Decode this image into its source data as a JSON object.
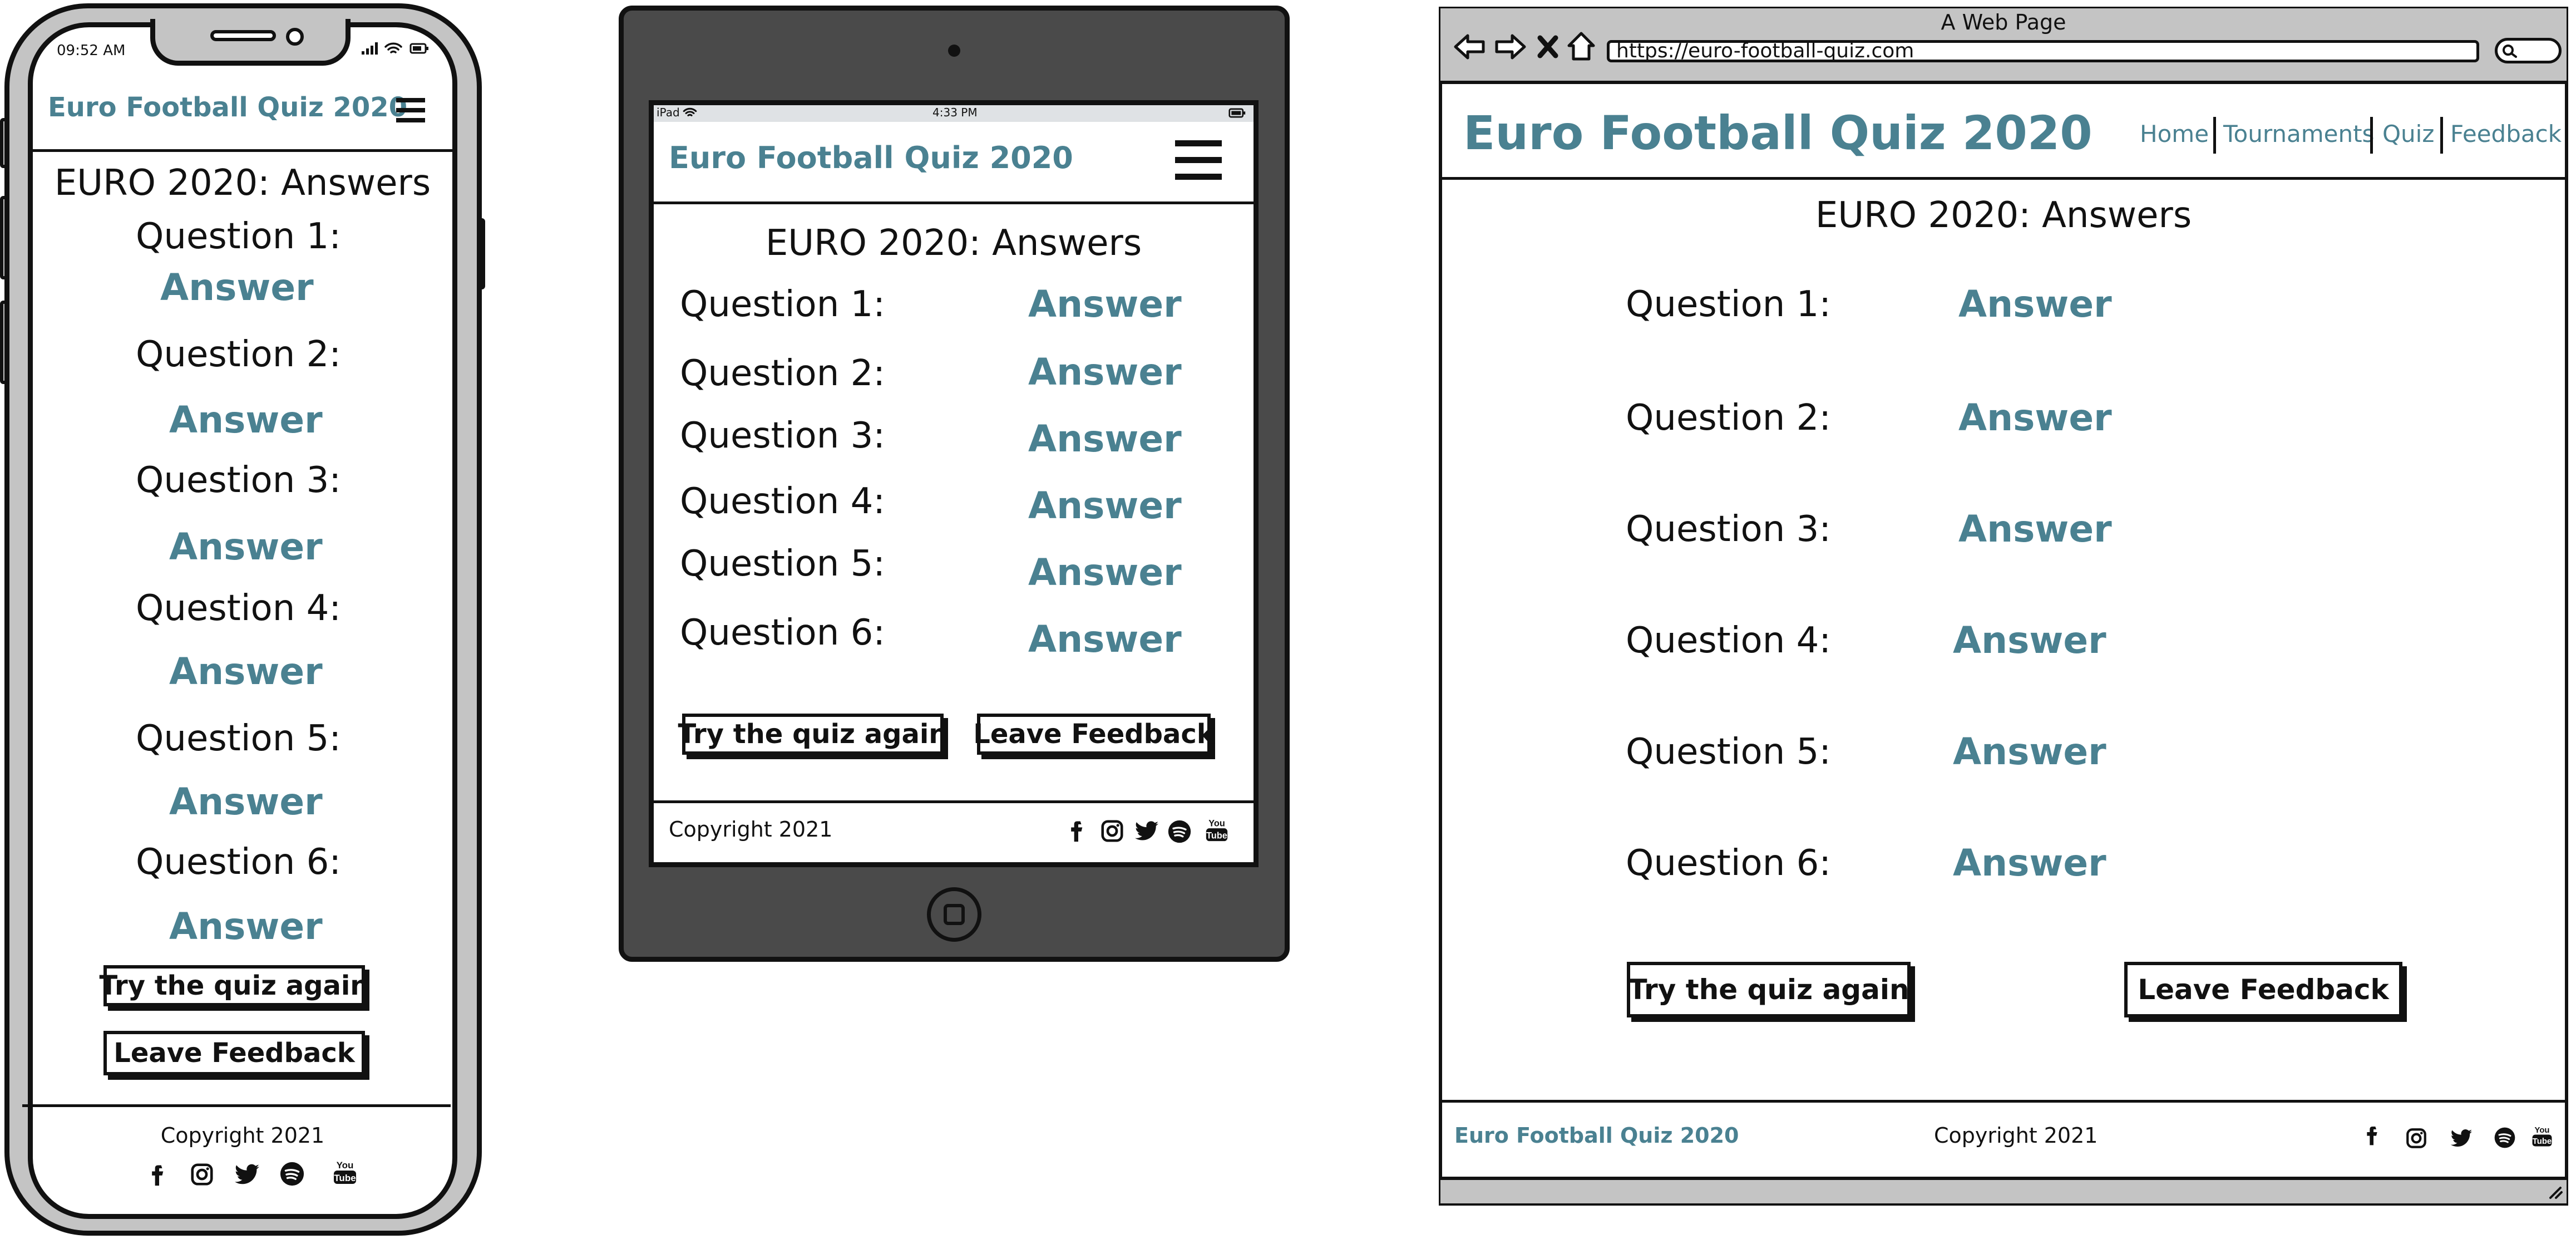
{
  "phone": {
    "status_time": "09:52 AM",
    "site_title": "Euro Football Quiz 2020",
    "heading": "EURO 2020: Answers",
    "questions": [
      {
        "label": "Question 1:",
        "answer": "Answer"
      },
      {
        "label": "Question 2:",
        "answer": "Answer"
      },
      {
        "label": "Question 3:",
        "answer": "Answer"
      },
      {
        "label": "Question 4:",
        "answer": "Answer"
      },
      {
        "label": "Question 5:",
        "answer": "Answer"
      },
      {
        "label": "Question 6:",
        "answer": "Answer"
      }
    ],
    "retry_button": "Try the quiz again",
    "feedback_button": "Leave Feedback",
    "copyright": "Copyright 2021",
    "social_icons": [
      "facebook-icon",
      "instagram-icon",
      "twitter-icon",
      "spotify-icon",
      "youtube-icon"
    ]
  },
  "tablet": {
    "status_device": "iPad",
    "status_time": "4:33 PM",
    "site_title": "Euro Football Quiz 2020",
    "heading": "EURO 2020: Answers",
    "questions": [
      {
        "label": "Question 1:",
        "answer": "Answer"
      },
      {
        "label": "Question 2:",
        "answer": "Answer"
      },
      {
        "label": "Question 3:",
        "answer": "Answer"
      },
      {
        "label": "Question 4:",
        "answer": "Answer"
      },
      {
        "label": "Question 5:",
        "answer": "Answer"
      },
      {
        "label": "Question 6:",
        "answer": "Answer"
      }
    ],
    "retry_button": "Try the quiz again",
    "feedback_button": "Leave Feedback",
    "copyright": "Copyright 2021"
  },
  "desktop": {
    "window_title": "A Web Page",
    "url": "https://euro-football-quiz.com",
    "site_title": "Euro Football Quiz 2020",
    "nav": [
      "Home",
      "Tournaments",
      "Quiz",
      "Feedback"
    ],
    "heading": "EURO 2020: Answers",
    "questions": [
      {
        "label": "Question 1:",
        "answer": "Answer"
      },
      {
        "label": "Question 2:",
        "answer": "Answer"
      },
      {
        "label": "Question 3:",
        "answer": "Answer"
      },
      {
        "label": "Question 4:",
        "answer": "Answer"
      },
      {
        "label": "Question 5:",
        "answer": "Answer"
      },
      {
        "label": "Question 6:",
        "answer": "Answer"
      }
    ],
    "retry_button": "Try the quiz again",
    "feedback_button": "Leave Feedback",
    "footer_title": "Euro Football Quiz 2020",
    "copyright": "Copyright 2021"
  },
  "colors": {
    "accent": "#4a8191",
    "frame": "#c4c4c4",
    "tablet_body": "#4a4a4a",
    "line": "#111111"
  }
}
